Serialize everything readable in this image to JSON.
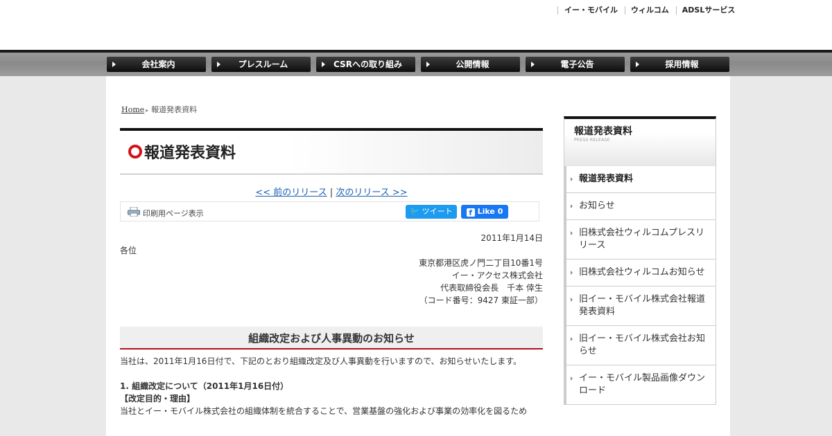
{
  "header": {
    "top_links": [
      "イー・モバイル",
      "ウィルコム",
      "ADSLサービス"
    ],
    "nav": [
      "会社案内",
      "プレスルーム",
      "CSRへの取り組み",
      "公開情報",
      "電子公告",
      "採用情報"
    ]
  },
  "breadcrumb": {
    "home": "Home",
    "current": "報道発表資料"
  },
  "page_title": "報道発表資料",
  "release_nav": {
    "prev": "<< 前のリリース",
    "sep": "|",
    "next": "次のリリース >>"
  },
  "toolbar": {
    "print": "印刷用ページ表示",
    "tweet": "ツイート",
    "like": "Like 0"
  },
  "letter": {
    "date": "2011年1月14日",
    "addressee": "各位",
    "sender": [
      "東京都港区虎ノ門二丁目10番1号",
      "イー・アクセス株式会社",
      "代表取締役会長　千本 倖生",
      "（コード番号：9427 東証一部）"
    ]
  },
  "notice": {
    "title": "組織改定および人事異動のお知らせ",
    "intro": "当社は、2011年1月16日付で、下記のとおり組織改定及び人事異動を行いますので、お知らせいたします。",
    "section1_heading": "1. 組織改定について（2011年1月16日付）",
    "purpose_heading": "【改定目的・理由】",
    "purpose_text": "当社とイー・モバイル株式会社の組織体制を統合することで、営業基盤の強化および事業の効率化を図るため"
  },
  "sidebar": {
    "title": "報道発表資料",
    "subtitle": "PRESS RELEASE",
    "items": [
      "報道発表資料",
      "お知らせ",
      "旧株式会社ウィルコムプレスリリース",
      "旧株式会社ウィルコムお知らせ",
      "旧イー・モバイル株式会社報道発表資料",
      "旧イー・モバイル株式会社お知らせ",
      "イー・モバイル製品画像ダウンロード"
    ]
  }
}
